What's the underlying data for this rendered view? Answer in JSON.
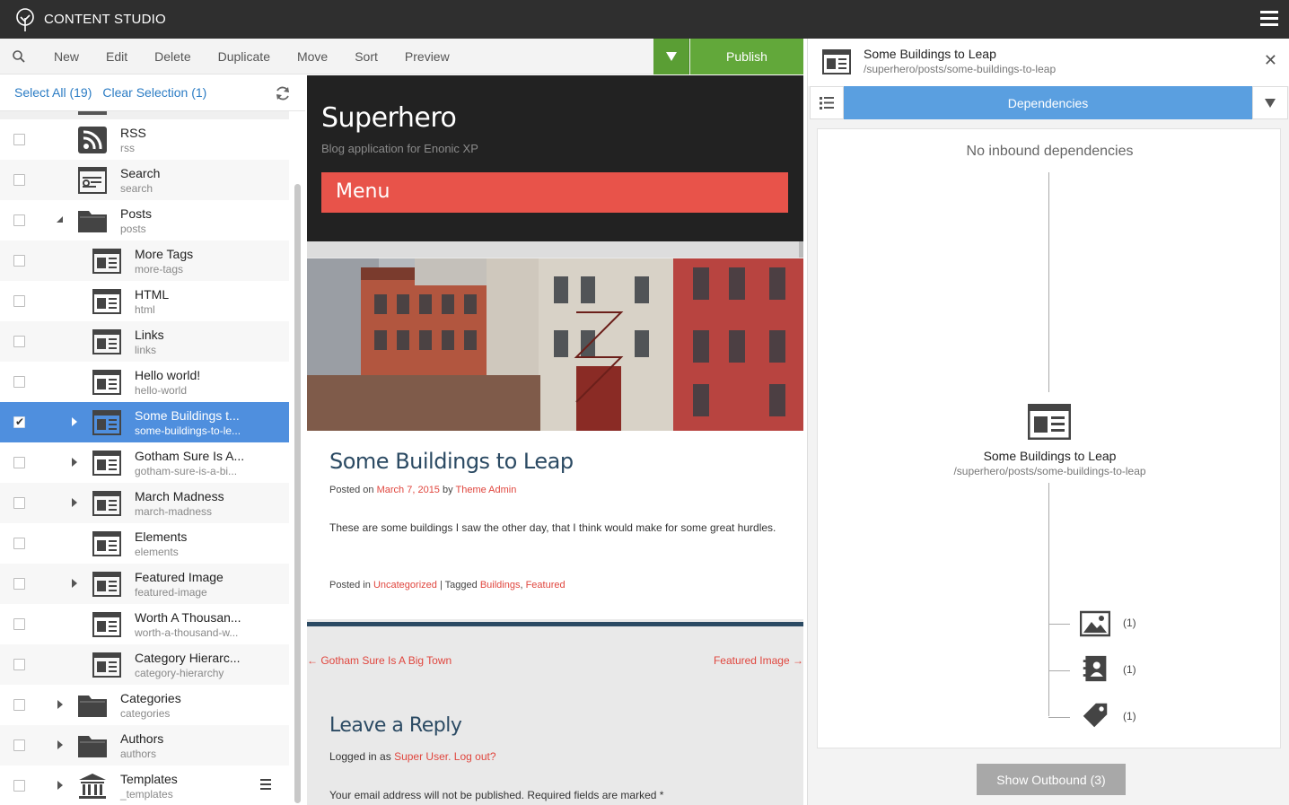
{
  "app": {
    "title": "CONTENT STUDIO"
  },
  "toolbar": {
    "new": "New",
    "edit": "Edit",
    "delete": "Delete",
    "duplicate": "Duplicate",
    "move": "Move",
    "sort": "Sort",
    "preview": "Preview",
    "publish": "Publish"
  },
  "selection": {
    "select_all": "Select All (19)",
    "clear": "Clear Selection (1)"
  },
  "tree": [
    {
      "title": "RSS",
      "sub": "rss",
      "icon": "rss-icon",
      "checked": false
    },
    {
      "title": "Search",
      "sub": "search",
      "icon": "search-page-icon",
      "checked": false
    },
    {
      "title": "Posts",
      "sub": "posts",
      "icon": "folder-icon",
      "checked": false
    },
    {
      "title": "More Tags",
      "sub": "more-tags",
      "icon": "article-icon",
      "checked": false
    },
    {
      "title": "HTML",
      "sub": "html",
      "icon": "article-icon",
      "checked": false
    },
    {
      "title": "Links",
      "sub": "links",
      "icon": "article-icon",
      "checked": false
    },
    {
      "title": "Hello world!",
      "sub": "hello-world",
      "icon": "article-icon",
      "checked": false
    },
    {
      "title": "Some Buildings t...",
      "sub": "some-buildings-to-le...",
      "icon": "article-icon",
      "checked": true
    },
    {
      "title": "Gotham Sure Is A...",
      "sub": "gotham-sure-is-a-bi...",
      "icon": "article-icon",
      "checked": false
    },
    {
      "title": "March Madness",
      "sub": "march-madness",
      "icon": "article-icon",
      "checked": false
    },
    {
      "title": "Elements",
      "sub": "elements",
      "icon": "article-icon",
      "checked": false
    },
    {
      "title": "Featured Image",
      "sub": "featured-image",
      "icon": "article-icon",
      "checked": false
    },
    {
      "title": "Worth A Thousan...",
      "sub": "worth-a-thousand-w...",
      "icon": "article-icon",
      "checked": false
    },
    {
      "title": "Category Hierarc...",
      "sub": "category-hierarchy",
      "icon": "article-icon",
      "checked": false
    },
    {
      "title": "Categories",
      "sub": "categories",
      "icon": "folder-icon",
      "checked": false
    },
    {
      "title": "Authors",
      "sub": "authors",
      "icon": "folder-icon",
      "checked": false
    },
    {
      "title": "Templates",
      "sub": "_templates",
      "icon": "templates-icon",
      "checked": false
    }
  ],
  "preview": {
    "site_title": "Superhero",
    "site_sub": "Blog application for Enonic XP",
    "menu": "Menu",
    "post_title": "Some Buildings to Leap",
    "posted_on": "Posted on",
    "date": "March 7, 2015",
    "by": "by",
    "author": "Theme Admin",
    "body": "These are some buildings I saw the other day, that I think would make for some great hurdles.",
    "posted_in": "Posted in",
    "category": "Uncategorized",
    "tagged": "| Tagged",
    "tag1": "Buildings",
    "comma": ",",
    "tag2": "Featured",
    "prev": "← Gotham Sure Is A Big Town",
    "next": "Featured Image →",
    "reply": "Leave a Reply",
    "logged_prefix": "Logged in as",
    "logged_user": "Super User.",
    "logout": "Log out?",
    "email_note": "Your email address will not be published. Required fields are marked *"
  },
  "detail": {
    "name": "Some Buildings to Leap",
    "path": "/superhero/posts/some-buildings-to-leap",
    "tab": "Dependencies",
    "no_inbound": "No inbound dependencies",
    "node_name": "Some Buildings to Leap",
    "node_path": "/superhero/posts/some-buildings-to-leap",
    "deps": [
      {
        "icon": "image-icon",
        "count": "(1)"
      },
      {
        "icon": "contact-book-icon",
        "count": "(1)"
      },
      {
        "icon": "tag-icon",
        "count": "(1)"
      }
    ],
    "show_outbound": "Show Outbound (3)"
  },
  "colors": {
    "publish": "#62a83a",
    "selected": "#4f8fde",
    "tab": "#5a9fe0",
    "accent_red": "#e0463e"
  }
}
